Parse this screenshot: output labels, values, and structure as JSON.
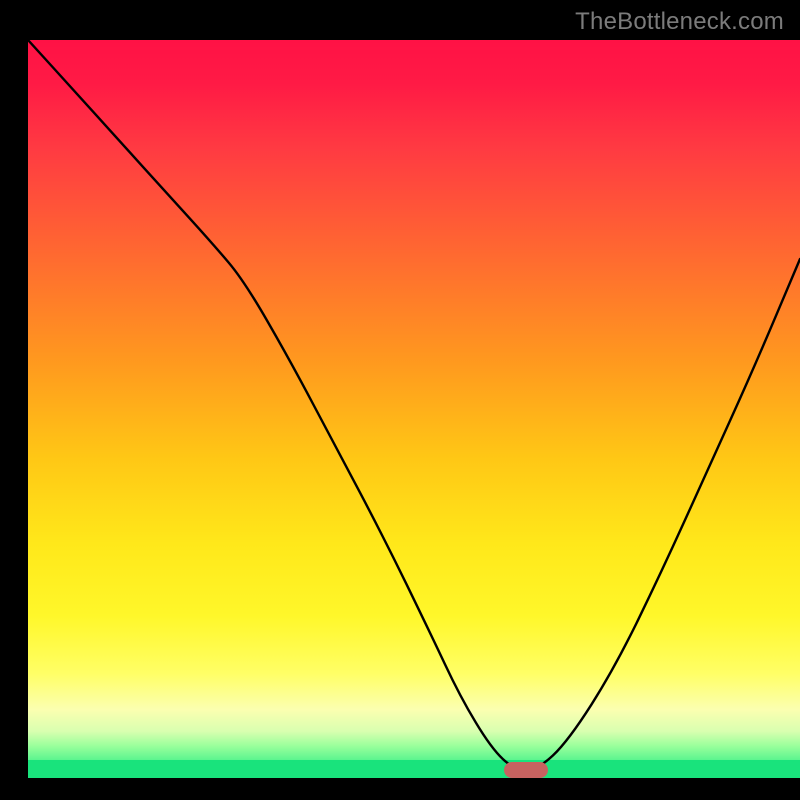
{
  "watermark": {
    "text": "TheBottleneck.com"
  },
  "colors": {
    "frame": "#000000",
    "marker": "#c76260",
    "green_strip": "#19e37c",
    "curve": "#000000"
  },
  "chart_data": {
    "type": "line",
    "title": "",
    "xlabel": "",
    "ylabel": "",
    "xlim": [
      0,
      100
    ],
    "ylim": [
      0,
      100
    ],
    "grid": false,
    "legend": false,
    "series": [
      {
        "name": "bottleneck-curve",
        "x": [
          0,
          6,
          12,
          18,
          24,
          28,
          34,
          40,
          46,
          52,
          56,
          60,
          63,
          66,
          70,
          76,
          82,
          88,
          94,
          100
        ],
        "y": [
          100,
          93,
          86,
          79,
          72,
          67,
          56,
          44,
          32,
          19,
          10,
          3,
          0,
          0,
          4,
          14,
          27,
          41,
          55,
          70
        ]
      }
    ],
    "marker": {
      "x": 64.5,
      "y": 0
    },
    "background_gradient": {
      "stops": [
        {
          "pos": 0.0,
          "color": "#ff1245"
        },
        {
          "pos": 0.3,
          "color": "#ff6a30"
        },
        {
          "pos": 0.58,
          "color": "#ffc715"
        },
        {
          "pos": 0.8,
          "color": "#fff72a"
        },
        {
          "pos": 0.96,
          "color": "#d9ffb0"
        },
        {
          "pos": 1.0,
          "color": "#5cf58f"
        }
      ]
    }
  }
}
